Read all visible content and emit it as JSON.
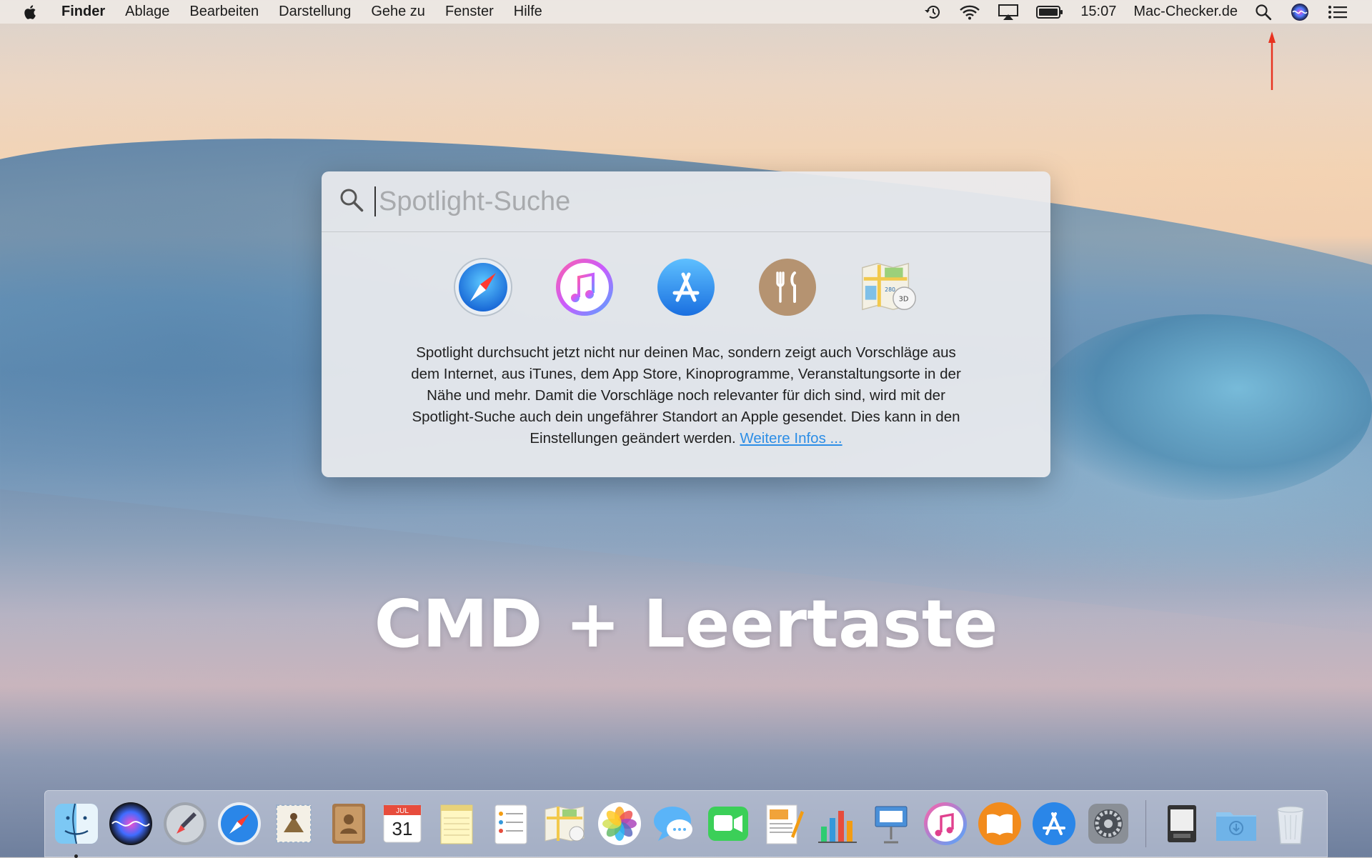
{
  "menubar": {
    "app_name": "Finder",
    "items": [
      "Ablage",
      "Bearbeiten",
      "Darstellung",
      "Gehe zu",
      "Fenster",
      "Hilfe"
    ],
    "clock": "15:07",
    "brand": "Mac-Checker.de",
    "status_icons": [
      "time-machine-icon",
      "wifi-icon",
      "airplay-icon",
      "battery-icon",
      "spotlight-icon",
      "siri-icon",
      "notification-center-icon"
    ]
  },
  "spotlight": {
    "placeholder": "Spotlight-Suche",
    "suggestion_icons": [
      "safari-icon",
      "itunes-icon",
      "app-store-icon",
      "restaurants-icon",
      "maps-icon"
    ],
    "info_text": "Spotlight durchsucht jetzt nicht nur deinen Mac, sondern zeigt auch Vorschläge aus dem Internet, aus iTunes, dem App Store, Kinoprogramme, Veranstaltungsorte in der Nähe und mehr. Damit die Vorschläge noch relevanter für dich sind, wird mit der Spotlight-Suche auch dein ungefährer Standort an Apple gesendet. Dies kann in den Einstellungen geändert werden.",
    "link_text": "Weitere Infos ..."
  },
  "overlay": {
    "shortcut": "CMD + Leertaste",
    "arrow_color": "#e8321f"
  },
  "dock": {
    "apps": [
      "finder",
      "siri",
      "launchpad",
      "safari",
      "mail",
      "contacts",
      "calendar",
      "notes",
      "reminders",
      "maps",
      "photos",
      "messages",
      "facetime",
      "pages",
      "numbers",
      "keynote",
      "itunes",
      "ibooks",
      "app-store",
      "system-preferences"
    ],
    "calendar_month": "JUL",
    "calendar_day": "31",
    "right_items": [
      "image-capture",
      "downloads",
      "trash"
    ]
  }
}
